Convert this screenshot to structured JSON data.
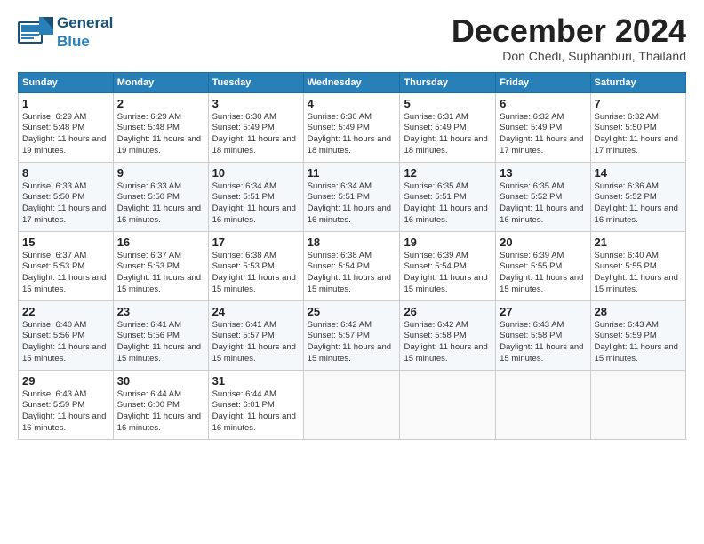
{
  "logo": {
    "text_general": "General",
    "text_blue": "Blue"
  },
  "title": "December 2024",
  "subtitle": "Don Chedi, Suphanburi, Thailand",
  "days_of_week": [
    "Sunday",
    "Monday",
    "Tuesday",
    "Wednesday",
    "Thursday",
    "Friday",
    "Saturday"
  ],
  "weeks": [
    [
      {
        "day": "1",
        "sunrise": "Sunrise: 6:29 AM",
        "sunset": "Sunset: 5:48 PM",
        "daylight": "Daylight: 11 hours and 19 minutes."
      },
      {
        "day": "2",
        "sunrise": "Sunrise: 6:29 AM",
        "sunset": "Sunset: 5:48 PM",
        "daylight": "Daylight: 11 hours and 19 minutes."
      },
      {
        "day": "3",
        "sunrise": "Sunrise: 6:30 AM",
        "sunset": "Sunset: 5:49 PM",
        "daylight": "Daylight: 11 hours and 18 minutes."
      },
      {
        "day": "4",
        "sunrise": "Sunrise: 6:30 AM",
        "sunset": "Sunset: 5:49 PM",
        "daylight": "Daylight: 11 hours and 18 minutes."
      },
      {
        "day": "5",
        "sunrise": "Sunrise: 6:31 AM",
        "sunset": "Sunset: 5:49 PM",
        "daylight": "Daylight: 11 hours and 18 minutes."
      },
      {
        "day": "6",
        "sunrise": "Sunrise: 6:32 AM",
        "sunset": "Sunset: 5:49 PM",
        "daylight": "Daylight: 11 hours and 17 minutes."
      },
      {
        "day": "7",
        "sunrise": "Sunrise: 6:32 AM",
        "sunset": "Sunset: 5:50 PM",
        "daylight": "Daylight: 11 hours and 17 minutes."
      }
    ],
    [
      {
        "day": "8",
        "sunrise": "Sunrise: 6:33 AM",
        "sunset": "Sunset: 5:50 PM",
        "daylight": "Daylight: 11 hours and 17 minutes."
      },
      {
        "day": "9",
        "sunrise": "Sunrise: 6:33 AM",
        "sunset": "Sunset: 5:50 PM",
        "daylight": "Daylight: 11 hours and 16 minutes."
      },
      {
        "day": "10",
        "sunrise": "Sunrise: 6:34 AM",
        "sunset": "Sunset: 5:51 PM",
        "daylight": "Daylight: 11 hours and 16 minutes."
      },
      {
        "day": "11",
        "sunrise": "Sunrise: 6:34 AM",
        "sunset": "Sunset: 5:51 PM",
        "daylight": "Daylight: 11 hours and 16 minutes."
      },
      {
        "day": "12",
        "sunrise": "Sunrise: 6:35 AM",
        "sunset": "Sunset: 5:51 PM",
        "daylight": "Daylight: 11 hours and 16 minutes."
      },
      {
        "day": "13",
        "sunrise": "Sunrise: 6:35 AM",
        "sunset": "Sunset: 5:52 PM",
        "daylight": "Daylight: 11 hours and 16 minutes."
      },
      {
        "day": "14",
        "sunrise": "Sunrise: 6:36 AM",
        "sunset": "Sunset: 5:52 PM",
        "daylight": "Daylight: 11 hours and 16 minutes."
      }
    ],
    [
      {
        "day": "15",
        "sunrise": "Sunrise: 6:37 AM",
        "sunset": "Sunset: 5:53 PM",
        "daylight": "Daylight: 11 hours and 15 minutes."
      },
      {
        "day": "16",
        "sunrise": "Sunrise: 6:37 AM",
        "sunset": "Sunset: 5:53 PM",
        "daylight": "Daylight: 11 hours and 15 minutes."
      },
      {
        "day": "17",
        "sunrise": "Sunrise: 6:38 AM",
        "sunset": "Sunset: 5:53 PM",
        "daylight": "Daylight: 11 hours and 15 minutes."
      },
      {
        "day": "18",
        "sunrise": "Sunrise: 6:38 AM",
        "sunset": "Sunset: 5:54 PM",
        "daylight": "Daylight: 11 hours and 15 minutes."
      },
      {
        "day": "19",
        "sunrise": "Sunrise: 6:39 AM",
        "sunset": "Sunset: 5:54 PM",
        "daylight": "Daylight: 11 hours and 15 minutes."
      },
      {
        "day": "20",
        "sunrise": "Sunrise: 6:39 AM",
        "sunset": "Sunset: 5:55 PM",
        "daylight": "Daylight: 11 hours and 15 minutes."
      },
      {
        "day": "21",
        "sunrise": "Sunrise: 6:40 AM",
        "sunset": "Sunset: 5:55 PM",
        "daylight": "Daylight: 11 hours and 15 minutes."
      }
    ],
    [
      {
        "day": "22",
        "sunrise": "Sunrise: 6:40 AM",
        "sunset": "Sunset: 5:56 PM",
        "daylight": "Daylight: 11 hours and 15 minutes."
      },
      {
        "day": "23",
        "sunrise": "Sunrise: 6:41 AM",
        "sunset": "Sunset: 5:56 PM",
        "daylight": "Daylight: 11 hours and 15 minutes."
      },
      {
        "day": "24",
        "sunrise": "Sunrise: 6:41 AM",
        "sunset": "Sunset: 5:57 PM",
        "daylight": "Daylight: 11 hours and 15 minutes."
      },
      {
        "day": "25",
        "sunrise": "Sunrise: 6:42 AM",
        "sunset": "Sunset: 5:57 PM",
        "daylight": "Daylight: 11 hours and 15 minutes."
      },
      {
        "day": "26",
        "sunrise": "Sunrise: 6:42 AM",
        "sunset": "Sunset: 5:58 PM",
        "daylight": "Daylight: 11 hours and 15 minutes."
      },
      {
        "day": "27",
        "sunrise": "Sunrise: 6:43 AM",
        "sunset": "Sunset: 5:58 PM",
        "daylight": "Daylight: 11 hours and 15 minutes."
      },
      {
        "day": "28",
        "sunrise": "Sunrise: 6:43 AM",
        "sunset": "Sunset: 5:59 PM",
        "daylight": "Daylight: 11 hours and 15 minutes."
      }
    ],
    [
      {
        "day": "29",
        "sunrise": "Sunrise: 6:43 AM",
        "sunset": "Sunset: 5:59 PM",
        "daylight": "Daylight: 11 hours and 16 minutes."
      },
      {
        "day": "30",
        "sunrise": "Sunrise: 6:44 AM",
        "sunset": "Sunset: 6:00 PM",
        "daylight": "Daylight: 11 hours and 16 minutes."
      },
      {
        "day": "31",
        "sunrise": "Sunrise: 6:44 AM",
        "sunset": "Sunset: 6:01 PM",
        "daylight": "Daylight: 11 hours and 16 minutes."
      },
      null,
      null,
      null,
      null
    ]
  ]
}
